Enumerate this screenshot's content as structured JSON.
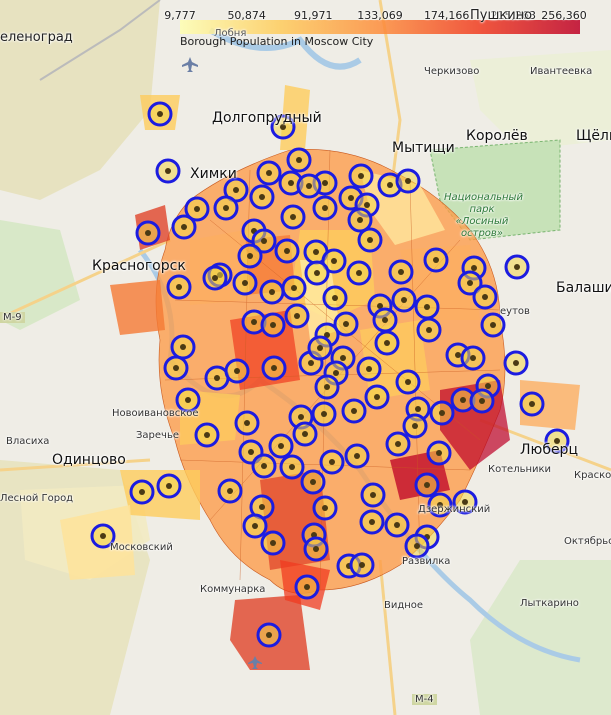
{
  "legend": {
    "caption": "Borough Population in Moscow City",
    "ticks": [
      "9,777",
      "50,874",
      "91,971",
      "133,069",
      "174,166",
      "215,263",
      "256,360"
    ],
    "colors": [
      "#ffffb2",
      "#fecc5c",
      "#fd8d3c",
      "#f03b20",
      "#bd0026"
    ]
  },
  "places": {
    "zelenograd": "еленоград",
    "dolgoprudny": "Долгопрудный",
    "khimki": "Химки",
    "mytishchi": "Мытищи",
    "korolev": "Королёв",
    "shchelk": "Щёлк",
    "cherkizovo": "Черкизово",
    "ivanteevka": "Ивантеевка",
    "park": "Национальный парк «Лосиный остров»",
    "krasnogorsk": "Красногорск",
    "balashikha": "Балаших",
    "novoivanovskoe": "Новоивановское",
    "zarechye": "Заречье",
    "odintsovo": "Одинцово",
    "vlasikha": "Власиха",
    "lesnoy": "Лесной Город",
    "moskovsky": "Московский",
    "kommunarka": "Коммунарка",
    "dzerzhinsky": "Дзержинский",
    "lyubertsy": "Люберц",
    "kotelniki": "Котельники",
    "kraskovo": "Краско",
    "razvilka": "Развилка",
    "vidnoe": "Видное",
    "oktyabrsky": "Октябрьс",
    "lytkarino": "Лыткарино",
    "reutov": "еутов",
    "m4": "М-4",
    "m9": "М-9",
    "lobnya": "Лобня",
    "pushkino": "Пушкино"
  }
}
